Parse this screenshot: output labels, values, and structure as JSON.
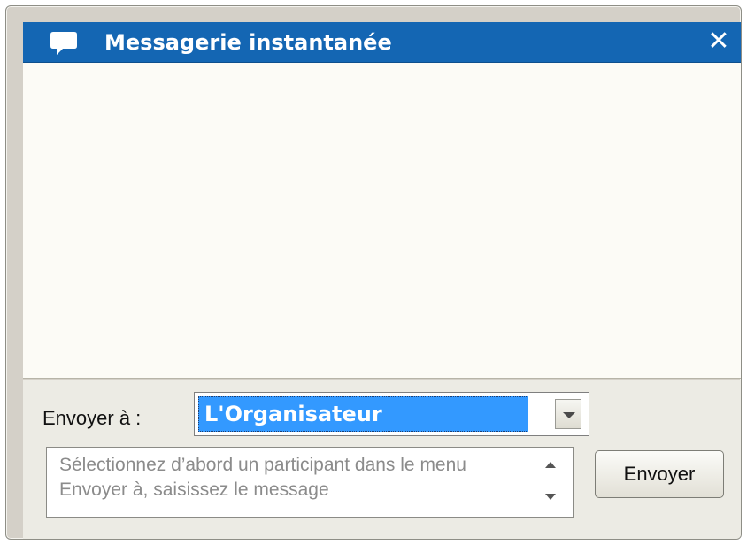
{
  "window": {
    "title": "Messagerie instantanée",
    "title_icon": "speech-bubble-icon",
    "close_icon": "close-icon",
    "close_glyph": "✕"
  },
  "footer": {
    "recipient_label": "Envoyer à :",
    "recipient_selected": "L'Organisateur",
    "message_placeholder": "Sélectionnez d’abord un participant dans le menu Envoyer à, saisissez le message",
    "send_label": "Envoyer"
  },
  "colors": {
    "titlebar": "#1466b3",
    "selection": "#3399ff",
    "background": "#ecebe4"
  }
}
